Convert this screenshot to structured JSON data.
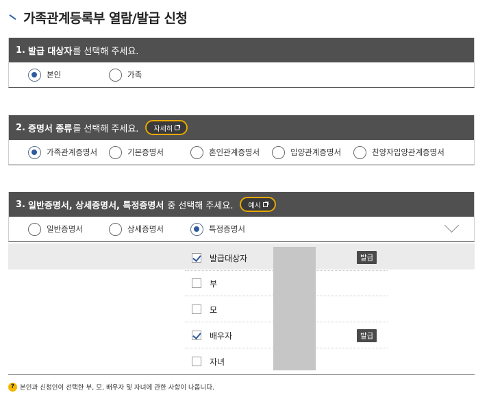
{
  "page": {
    "title": "가족관계등록부 열람/발급 신청"
  },
  "section1": {
    "num": "1.",
    "heading_bold": "발급 대상자",
    "heading_rest": "를 선택해 주세요.",
    "options": [
      {
        "label": "본인",
        "selected": true
      },
      {
        "label": "가족",
        "selected": false
      }
    ]
  },
  "section2": {
    "num": "2.",
    "heading_bold": "증명서 종류",
    "heading_rest": "를 선택해 주세요.",
    "button_label": "자세히",
    "options": [
      {
        "label": "가족관계증명서",
        "selected": true
      },
      {
        "label": "기본증명서",
        "selected": false
      },
      {
        "label": "혼인관계증명서",
        "selected": false
      },
      {
        "label": "입양관계증명서",
        "selected": false
      },
      {
        "label": "친양자입양관계증명서",
        "selected": false
      }
    ]
  },
  "section3": {
    "num": "3.",
    "heading_bold": "일반증명서, 상세증명서, 특정증명서",
    "heading_rest": "중 선택해 주세요.",
    "button_label": "예시",
    "options": [
      {
        "label": "일반증명서",
        "selected": false
      },
      {
        "label": "상세증명서",
        "selected": false
      },
      {
        "label": "특정증명서",
        "selected": true
      }
    ],
    "targets": [
      {
        "label": "발급대상자",
        "checked": true,
        "badge": "발급"
      },
      {
        "label": "부",
        "checked": false,
        "badge": ""
      },
      {
        "label": "모",
        "checked": false,
        "badge": ""
      },
      {
        "label": "배우자",
        "checked": true,
        "badge": "발급"
      },
      {
        "label": "자녀",
        "checked": false,
        "badge": ""
      }
    ]
  },
  "note": {
    "icon": "question-icon",
    "icon_char": "?",
    "text": "본인과 신청인이 선택한 부, 모, 배우자 및 자녀에 관한 사항이 나옵니다."
  },
  "colors": {
    "header": "#505050",
    "accent": "#2f5a9e",
    "pill_border": "#e8a800"
  }
}
